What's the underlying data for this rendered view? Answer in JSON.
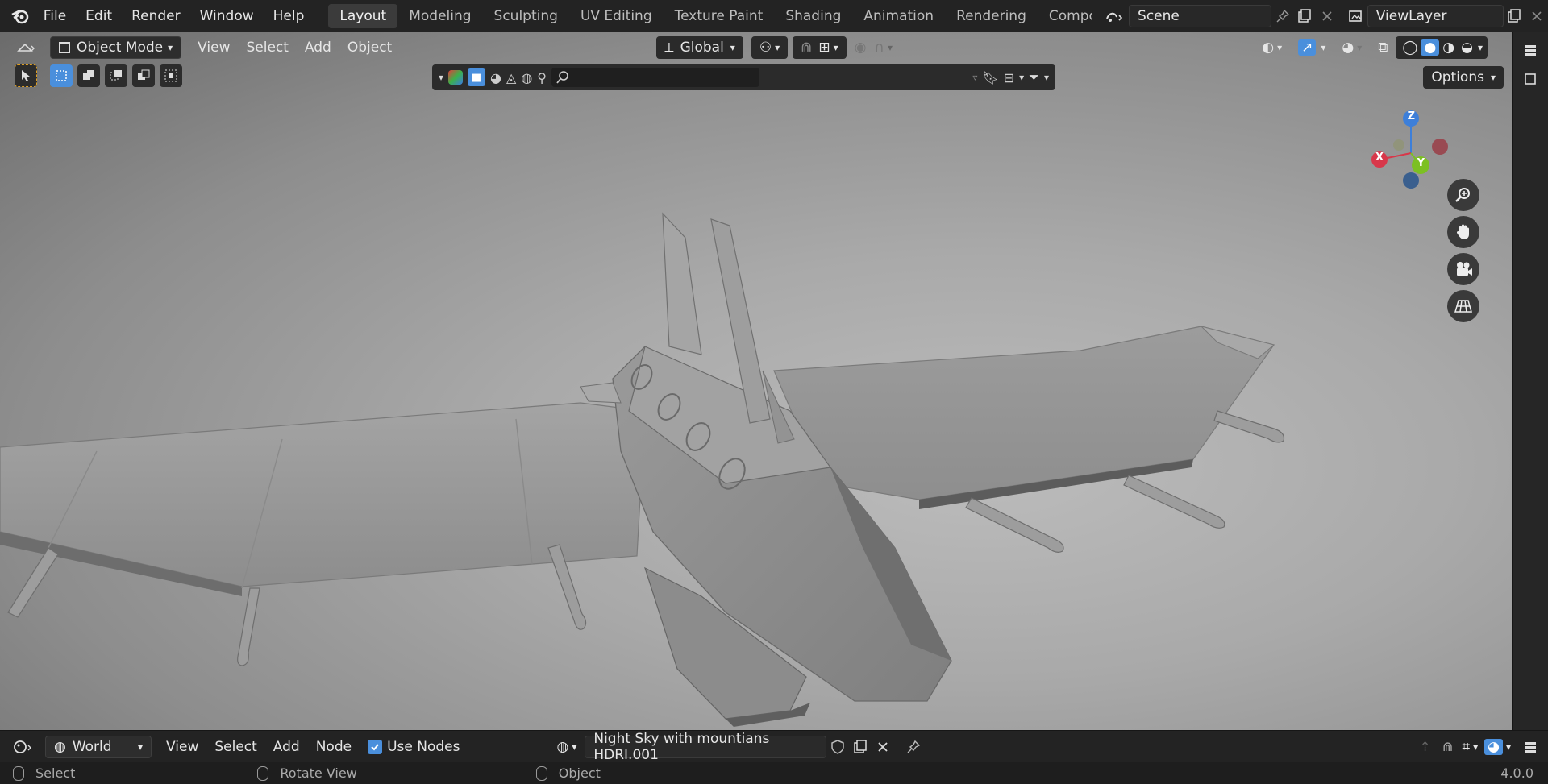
{
  "topbar": {
    "menus": [
      "File",
      "Edit",
      "Render",
      "Window",
      "Help"
    ],
    "workspaces": [
      "Layout",
      "Modeling",
      "Sculpting",
      "UV Editing",
      "Texture Paint",
      "Shading",
      "Animation",
      "Rendering",
      "Compositing"
    ],
    "active_workspace": "Layout",
    "scene_name": "Scene",
    "view_layer": "ViewLayer"
  },
  "viewport_header": {
    "mode": "Object Mode",
    "menus": [
      "View",
      "Select",
      "Add",
      "Object"
    ],
    "transform_orientation": "Global",
    "options_label": "Options"
  },
  "gizmo": {
    "z": "Z",
    "x": "X",
    "y": "Y"
  },
  "node_header": {
    "editor_type": "World",
    "menus": [
      "View",
      "Select",
      "Add",
      "Node"
    ],
    "use_nodes_label": "Use Nodes",
    "use_nodes_checked": true,
    "world_name": "Night Sky with mountians HDRI.001"
  },
  "statusbar": {
    "select": "Select",
    "rotate": "Rotate View",
    "object": "Object",
    "version": "4.0.0"
  },
  "colors": {
    "accent_blue": "#4a8fdc",
    "axis_x": "#d8374a",
    "axis_y": "#7cc022",
    "axis_z": "#3d7fd9"
  }
}
